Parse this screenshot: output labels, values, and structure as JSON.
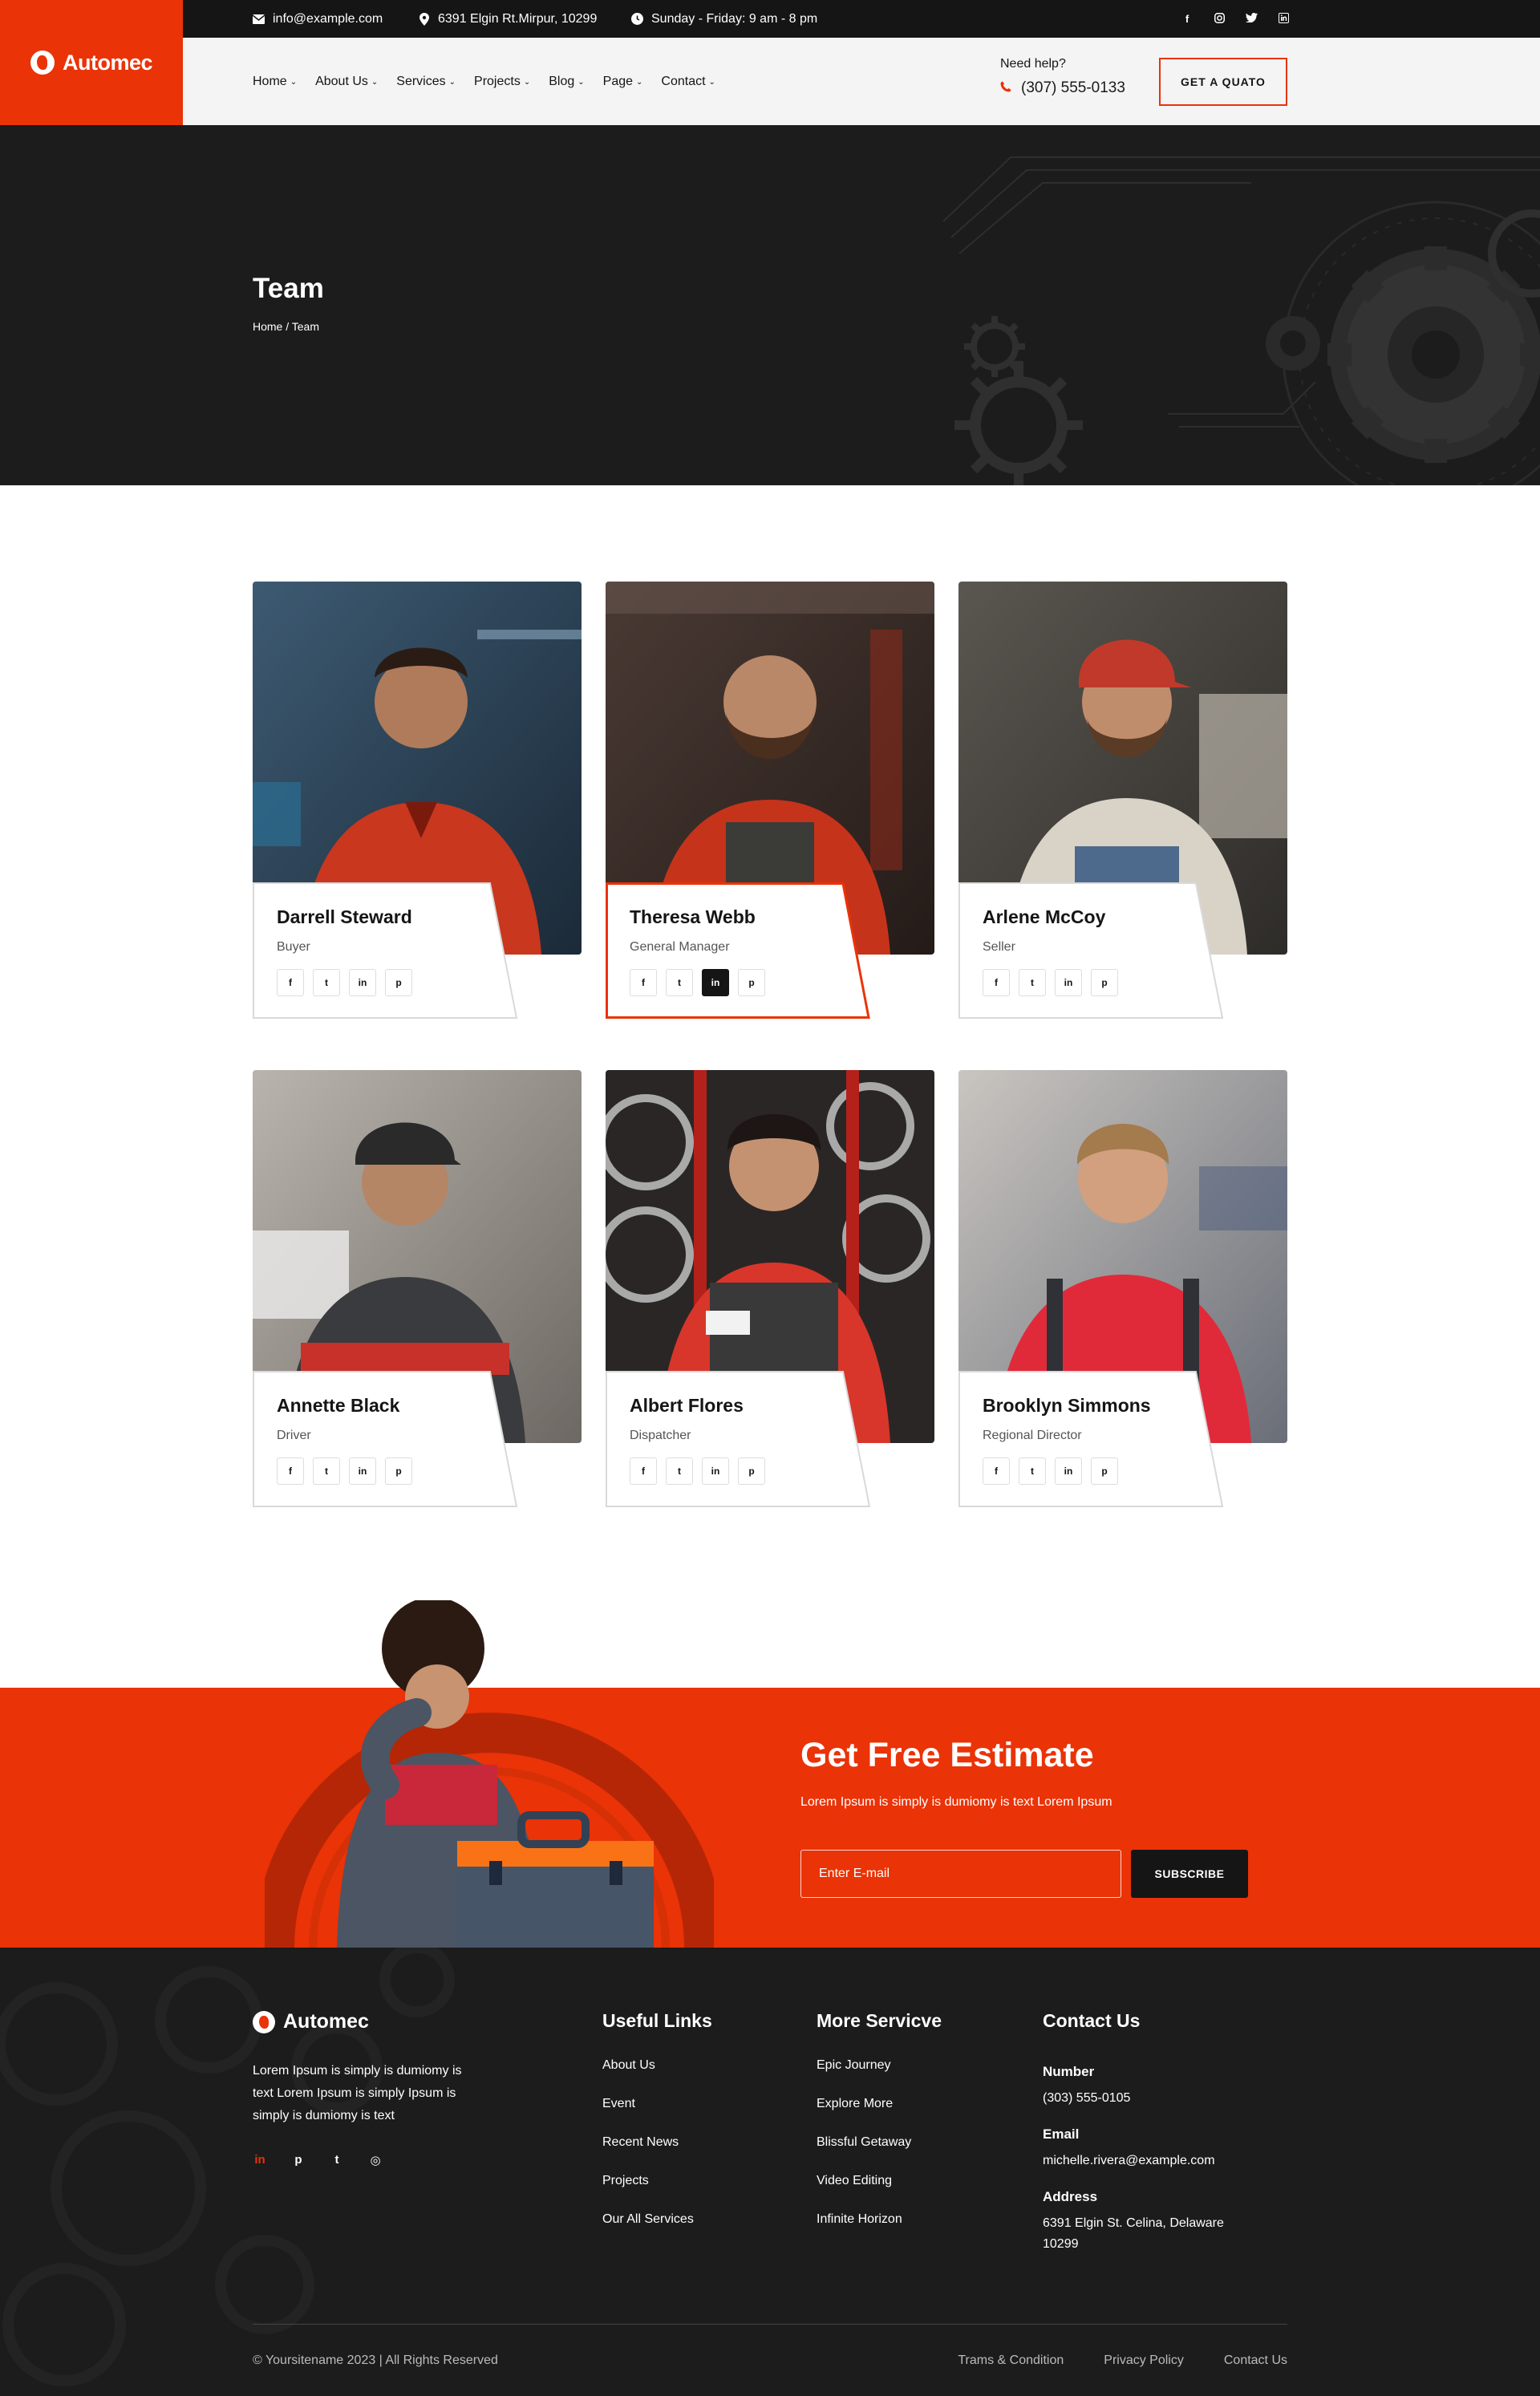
{
  "brand": {
    "name": "Automec"
  },
  "topbar": {
    "email": "info@example.com",
    "address": "6391 Elgin Rt.Mirpur, 10299",
    "hours": "Sunday - Friday:  9 am - 8 pm",
    "social_icons": [
      "facebook-icon",
      "instagram-icon",
      "twitter-icon",
      "linkedin-icon"
    ]
  },
  "nav": {
    "items": [
      {
        "label": "Home"
      },
      {
        "label": "About Us"
      },
      {
        "label": "Services"
      },
      {
        "label": "Projects"
      },
      {
        "label": "Blog"
      },
      {
        "label": "Page"
      },
      {
        "label": "Contact"
      }
    ],
    "help_label": "Need help?",
    "phone": "(307) 555-0133",
    "cta": "GET A QUATO"
  },
  "hero": {
    "title": "Team",
    "breadcrumb": "Home / Team"
  },
  "team": [
    {
      "name": "Darrell Steward",
      "role": "Buyer"
    },
    {
      "name": "Theresa Webb",
      "role": "General Manager"
    },
    {
      "name": "Arlene McCoy",
      "role": "Seller"
    },
    {
      "name": "Annette Black",
      "role": "Driver"
    },
    {
      "name": "Albert Flores",
      "role": "Dispatcher"
    },
    {
      "name": "Brooklyn Simmons",
      "role": "Regional Director"
    }
  ],
  "estimate": {
    "title": "Get Free Estimate",
    "subtitle": "Lorem Ipsum is simply is dumiomy is text Lorem Ipsum",
    "email_placeholder": "Enter E-mail",
    "button": "SUBSCRIBE"
  },
  "footer": {
    "about": "Lorem Ipsum is simply is dumiomy is text Lorem Ipsum is simply  Ipsum is simply is dumiomy is text",
    "useful_links": {
      "title": "Useful Links",
      "items": [
        "About Us",
        "Event",
        "Recent News",
        "Projects",
        "Our All Services"
      ]
    },
    "more_service": {
      "title": "More Servicve",
      "items": [
        "Epic Journey",
        "Explore More",
        "Blissful Getaway",
        "Video Editing",
        "Infinite Horizon"
      ]
    },
    "contact": {
      "title": "Contact Us",
      "number_label": "Number",
      "number": "(303) 555-0105",
      "email_label": "Email",
      "email": "michelle.rivera@example.com",
      "address_label": "Address",
      "address": "6391 Elgin St. Celina, Delaware 10299"
    },
    "copyright": "© Yoursitename  2023 | All Rights Reserved",
    "legal": [
      "Trams & Condition",
      "Privacy Policy",
      "Contact Us"
    ]
  },
  "colors": {
    "accent": "#ea3307",
    "dark": "#1c1c1c",
    "topbar": "#151515"
  }
}
